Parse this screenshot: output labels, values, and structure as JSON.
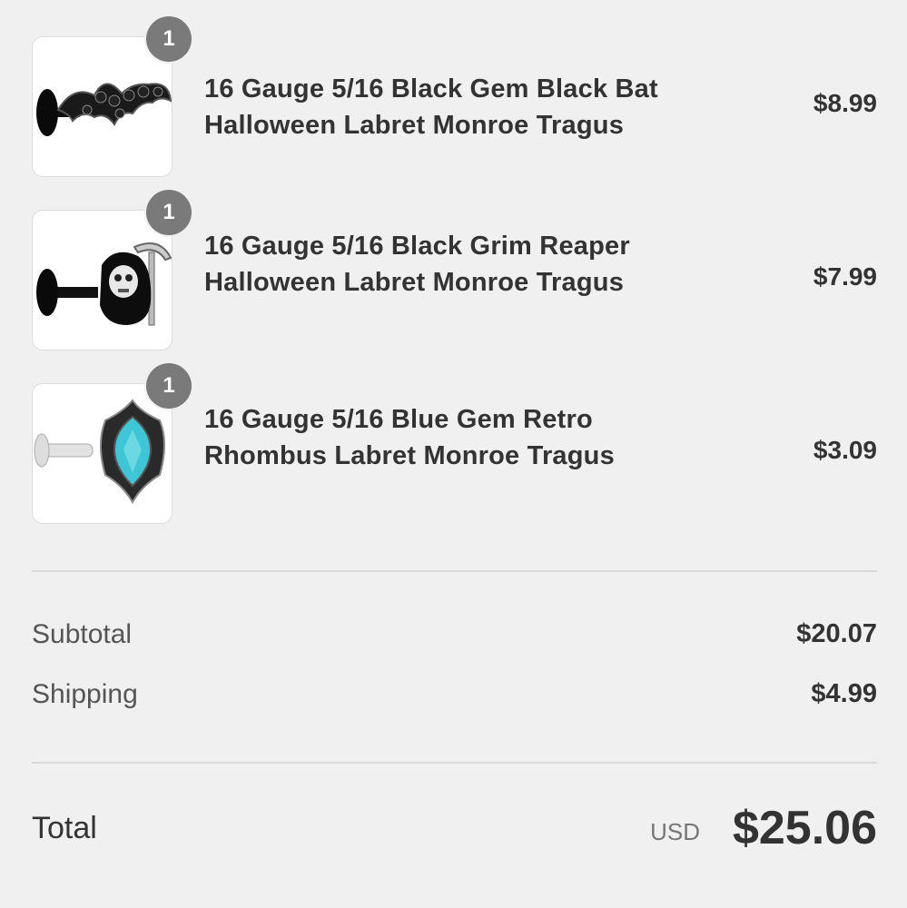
{
  "items": [
    {
      "title_line1": "16 Gauge 5/16 Black Gem Black Bat",
      "title_line2": "Halloween Labret Monroe Tragus",
      "price": "$8.99",
      "quantity": "1",
      "image_icon": "bat-labret-image"
    },
    {
      "title_line1": "16 Gauge 5/16 Black Grim Reaper",
      "title_line2": "Halloween Labret Monroe Tragus",
      "price": "$7.99",
      "quantity": "1",
      "image_icon": "grim-reaper-labret-image"
    },
    {
      "title_line1": "16 Gauge 5/16 Blue Gem Retro",
      "title_line2": "Rhombus Labret Monroe Tragus",
      "price": "$3.09",
      "quantity": "1",
      "image_icon": "blue-gem-rhombus-labret-image"
    }
  ],
  "summary": {
    "subtotal_label": "Subtotal",
    "subtotal_value": "$20.07",
    "shipping_label": "Shipping",
    "shipping_value": "$4.99"
  },
  "total": {
    "label": "Total",
    "currency": "USD",
    "value": "$25.06"
  },
  "colors": {
    "background": "#f0f0f0",
    "badge": "#7a7a7a",
    "text": "#333333",
    "gem_blue": "#3fc6d6"
  }
}
